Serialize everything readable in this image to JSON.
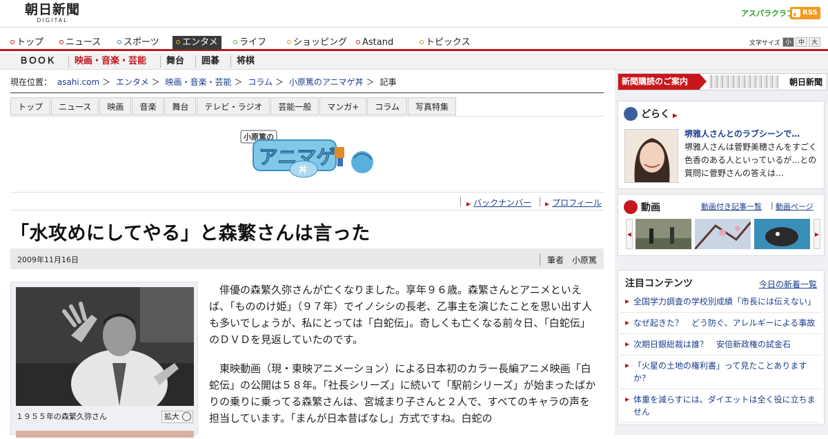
{
  "header": {
    "logo_main": "朝日新聞",
    "logo_sub": "DIGITAL",
    "asupara": "アスパラクラブ",
    "rss": "RSS"
  },
  "nav_main": [
    "トップ",
    "ニュース",
    "スポーツ",
    "エンタメ",
    "ライフ",
    "ショッピング",
    "Astand",
    "トピックス"
  ],
  "font_size": {
    "label": "文字サイズ",
    "small": "小",
    "medium": "中",
    "large": "大"
  },
  "nav_sub": [
    "ＢＯＯＫ",
    "映画・音楽・芸能",
    "舞台",
    "囲碁",
    "将棋"
  ],
  "breadcrumb": {
    "prefix": "現在位置：",
    "items": [
      "asahi.com",
      "エンタメ",
      "映画・音楽・芸能",
      "コラム",
      "小原篤のアニマゲ丼"
    ],
    "sep": "＞",
    "current": "記事"
  },
  "section_tabs": [
    "トップ",
    "ニュース",
    "映画",
    "音楽",
    "舞台",
    "テレビ・ラジオ",
    "芸能一般",
    "マンガ+",
    "コラム",
    "写真特集"
  ],
  "banner": {
    "author": "小原篤の",
    "title": "アニマゲ",
    "sub": "丼"
  },
  "article_links": {
    "back_number": "バックナンバー",
    "profile": "プロフィール"
  },
  "article": {
    "title": "「水攻めにしてやる」と森繁さんは言った",
    "date": "2009年11月16日",
    "author": "筆者　小原篤",
    "photo_caption": "１９５５年の森繁久弥さん",
    "expand": "拡大",
    "paragraphs": [
      "俳優の森繁久弥さんが亡くなりました。享年９６歳。森繁さんとアニメといえば、「もののけ姫」（９７年）でイノシシの長老、乙事主を演じたことを思い出す人も多いでしょうが、私にとっては「白蛇伝」。奇しくも亡くなる前々日、「白蛇伝」のＤＶＤを見返していたのです。",
      "東映動画（現・東映アニメーション）による日本初のカラー長編アニメ映画「白蛇伝」の公開は５８年。「社長シリーズ」に続いて「駅前シリーズ」が始まったばかりの乗りに乗ってる森繁さんは、宮城まり子さんと２人で、すべてのキャラの声を担当しています。「まんが日本昔ばなし」方式ですね。白蛇の"
    ]
  },
  "sidebar": {
    "subscribe": {
      "label": "新聞購読のご案内",
      "logo": "朝日新聞"
    },
    "doraku": {
      "title": "どらく",
      "link": "堺雅人さんとのラブシーンで…",
      "text": "堺雅人さんは菅野美穂さんをすごく色香のある人といっているが…との質問に菅野さんの答えは…"
    },
    "video": {
      "title": "動画",
      "link1": "動画付き記事一覧",
      "sep": "|",
      "link2": "動画ページ"
    },
    "featured": {
      "title": "注目コンテンツ",
      "link": "今日の新着一覧",
      "items": [
        "全国学力調査の学校別成績「市長には伝えない」",
        "なぜ起きた？　どう防ぐ、アレルギーによる事故",
        "次期日銀総裁は誰？　安倍新政権の試金石",
        "「火星の土地の権利書」って見たことありますか？",
        "体重を減らすには、ダイエットは全く役に立ちません"
      ]
    }
  },
  "colors": {
    "accent_red": "#c0171e",
    "link_blue": "#1a3d8f",
    "sidebar_bg": "#eef0f3"
  }
}
